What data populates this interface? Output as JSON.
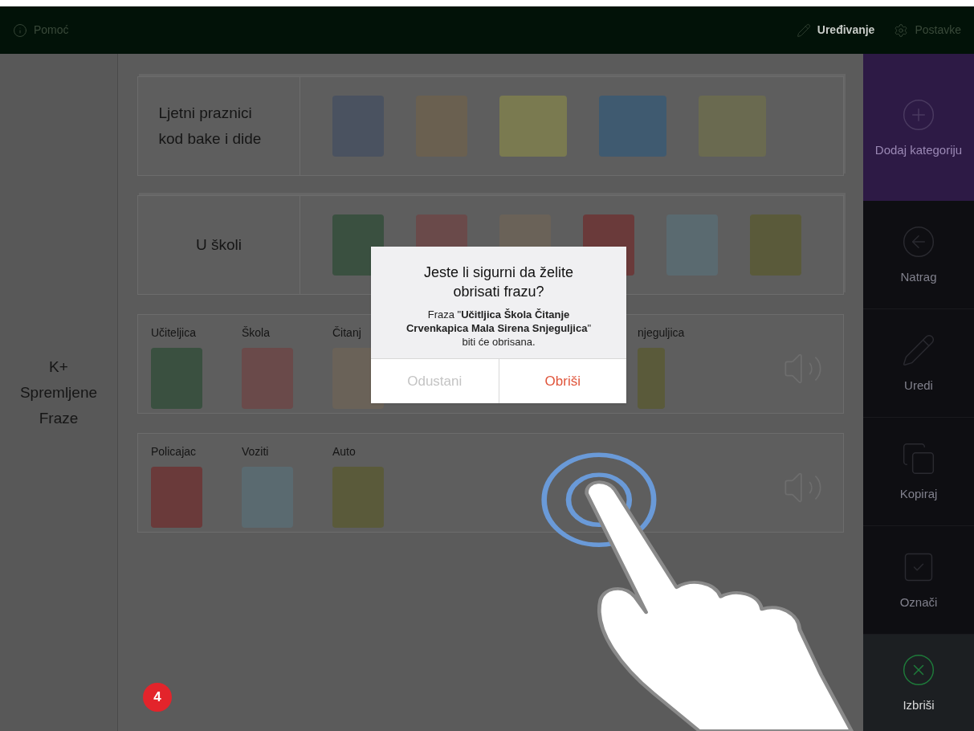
{
  "top_bar": {
    "help": "Pomoć",
    "edit": "Uređivanje",
    "settings": "Postavke"
  },
  "left_panel": {
    "title": "K+\nSpremljene\nFraze"
  },
  "categories": [
    {
      "title": "Ljetni praznici kod bake i dide"
    },
    {
      "title": "U školi"
    }
  ],
  "phrases": [
    {
      "words": [
        "Učiteljica",
        "Škola",
        "Čitanj"
      ],
      "trailing_words": [
        "njeguljica"
      ]
    },
    {
      "words": [
        "Policajac",
        "Voziti",
        "Auto"
      ]
    }
  ],
  "dialog": {
    "title": "Jeste li sigurni da želite obrisati frazu?",
    "message": "Fraza \"**Učitljica Škola Čitanje Crvenkapica Mala Sirena Snjeguljica**\" biti će obrisana.",
    "cancel": "Odustani",
    "confirm": "Obriši"
  },
  "sidebar": [
    {
      "kind": "add",
      "label": "Dodaj kategoriju",
      "highlighted": false
    },
    {
      "kind": "back",
      "label": "Natrag",
      "highlighted": false
    },
    {
      "kind": "edit",
      "label": "Uredi",
      "highlighted": false
    },
    {
      "kind": "copy",
      "label": "Kopiraj",
      "highlighted": false
    },
    {
      "kind": "mark",
      "label": "Označi",
      "highlighted": false
    },
    {
      "kind": "delete",
      "label": "Izbriši",
      "highlighted": true
    }
  ],
  "step_badge": "4"
}
